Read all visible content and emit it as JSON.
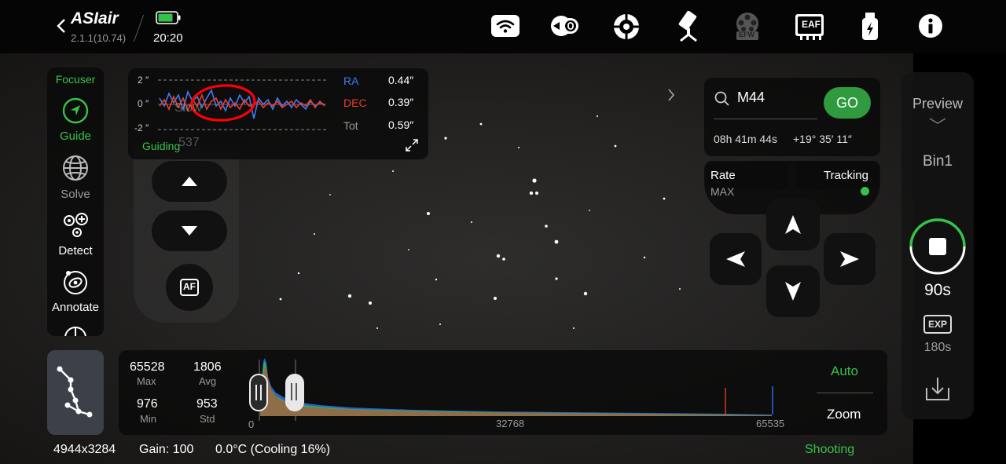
{
  "app": {
    "logo": "ASIair",
    "version": "2.1.1(10.74)",
    "time": "20:20",
    "battery_color": "#36c24a"
  },
  "top_icons": [
    "wifi-icon",
    "mount-icon",
    "crosshair-icon",
    "telescope-icon",
    "efw-icon",
    "eaf-icon",
    "usb-power-icon",
    "info-icon"
  ],
  "top_icon_labels": {
    "efw": "EFW",
    "eaf": "EAF"
  },
  "left_nav": {
    "focuser": "Focuser",
    "items": [
      {
        "label": "Guide",
        "icon": "guide-icon",
        "active": true
      },
      {
        "label": "Solve",
        "icon": "globe-icon",
        "active": false
      },
      {
        "label": "Detect",
        "icon": "detect-icon",
        "active": false
      },
      {
        "label": "Annotate",
        "icon": "annotate-icon",
        "active": false
      }
    ]
  },
  "guiding": {
    "y_top": "2 ″",
    "y_mid": "0 ″",
    "y_bot": "-2 ″",
    "overlay_slow": "Slow",
    "overlay_537": "537",
    "label": "Guiding",
    "ra_label": "RA",
    "ra_value": "0.44″",
    "dec_label": "DEC",
    "dec_value": "0.39″",
    "tot_label": "Tot",
    "tot_value": "0.59″",
    "ra_color": "#3d7df2",
    "dec_color": "#ee3a2c"
  },
  "focuser_controls": {
    "af_label": "AF"
  },
  "goto": {
    "search_value": "M44",
    "go_label": "GO",
    "ra": "08h 41m 44s",
    "dec": "+19° 35′ 11″",
    "rate_label": "Rate",
    "rate_value": "MAX",
    "tracking_label": "Tracking",
    "tracking_color": "#36c24a"
  },
  "right_panel": {
    "preview": "Preview",
    "bin": "Bin1",
    "exposure": "90s",
    "exp_badge": "EXP",
    "exp_total": "180s"
  },
  "stats": {
    "max_value": "65528",
    "max_label": "Max",
    "avg_value": "1806",
    "avg_label": "Avg",
    "min_value": "976",
    "min_label": "Min",
    "std_value": "953",
    "std_label": "Std"
  },
  "histogram": {
    "tick_0": "0",
    "tick_mid": "32768",
    "tick_max": "65535",
    "auto_label": "Auto",
    "zoom_label": "Zoom"
  },
  "status": {
    "resolution": "4944x3284",
    "gain": "Gain: 100",
    "temperature": "0.0°C (Cooling 16%)",
    "mode": "Shooting"
  }
}
